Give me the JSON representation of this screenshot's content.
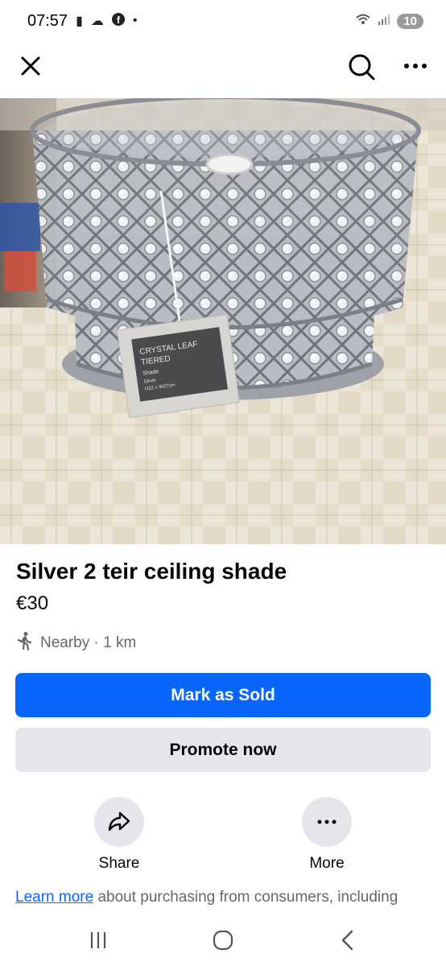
{
  "status_bar": {
    "time": "07:57",
    "battery": "10",
    "icons": [
      "battery-saver-icon",
      "cloud-icon",
      "facebook-icon",
      "dot-icon",
      "wifi-icon",
      "signal-icon"
    ]
  },
  "top_bar": {
    "icons": [
      "close-icon",
      "search-icon",
      "more-icon"
    ]
  },
  "product_image": {
    "tag_lines": [
      "CRYSTAL LEAF",
      "TIERED",
      "Shade",
      "Silver",
      "H22 x W27cm"
    ]
  },
  "listing": {
    "title": "Silver 2 teir ceiling shade",
    "price": "€30",
    "distance": "Nearby · 1 km"
  },
  "buttons": {
    "mark_sold": "Mark as Sold",
    "promote": "Promote now"
  },
  "actions": {
    "share": "Share",
    "more": "More"
  },
  "legal": {
    "link": "Learn more",
    "text": " about purchasing from consumers, including"
  },
  "colors": {
    "primary": "#0866ff",
    "secondary_bg": "#e4e6eb",
    "muted_text": "#65676b"
  }
}
